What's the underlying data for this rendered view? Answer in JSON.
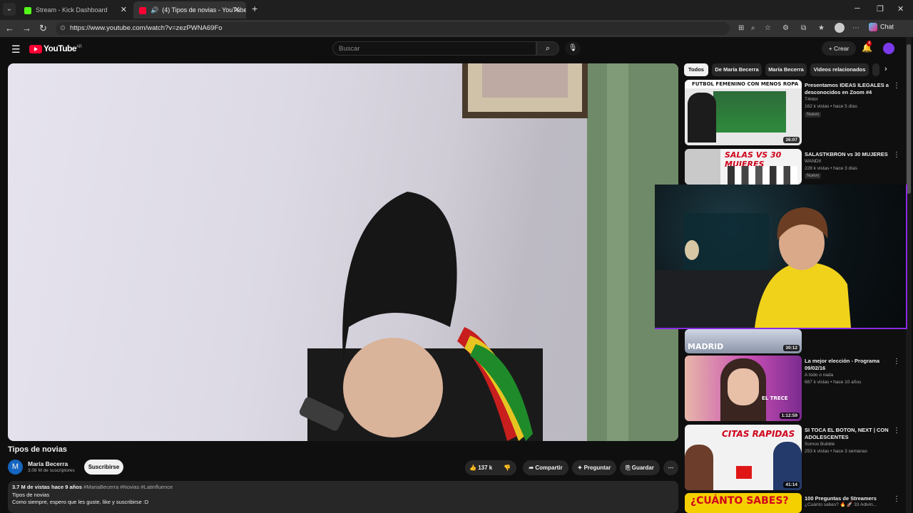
{
  "browser": {
    "tabs": [
      {
        "label": "Stream - Kick Dashboard",
        "icon": "kick-icon"
      },
      {
        "label": "(4) Tipos de novias - YouTube",
        "icon": "youtube-icon"
      }
    ],
    "url": "https://www.youtube.com/watch?v=zezPWNA69Fo",
    "chat_label": "Chat"
  },
  "youtube": {
    "logo_text": "YouTube",
    "logo_region": "AR",
    "search_placeholder": "Buscar",
    "create_label": "Crear",
    "notifications_count": "4"
  },
  "video": {
    "title": "Tipos de novias",
    "channel": "María Becerra",
    "channel_initial": "M",
    "subscribers": "3.08 M de suscriptores",
    "subscribe_label": "Suscribirse",
    "likes": "137 k",
    "share_label": "Compartir",
    "ask_label": "Preguntar",
    "save_label": "Guardar",
    "views": "3.7 M de vistas",
    "age": "hace 9 años",
    "hashtags": "#MariaBecerra #Novias #Latinfluence",
    "desc_line1": "Tipos de novias",
    "desc_line2": "Como siempre, espero que les guste, like y suscribirse :D"
  },
  "chips": [
    "Todos",
    "De María Becerra",
    "María Becerra",
    "Videos relacionados"
  ],
  "recommendations": [
    {
      "title": "Presentamos IDEAS ILEGALES a desconocidos en Zoom #4",
      "channel": "T4ntor",
      "meta": "162 k vistas • hace 5 días",
      "badge": "Nuevo",
      "duration": "36:07",
      "thumb_text": "FUTBOL FEMENINO CON MENOS ROPA"
    },
    {
      "title": "SALASTKBRON vs 30 MUJERES",
      "channel": "WANDII",
      "meta": "228 k vistas • hace 3 días",
      "badge": "Nuevo",
      "duration": "",
      "thumb_text": "SALAS VS 30 MUJERES"
    },
    {
      "title": "",
      "channel": "",
      "meta": "",
      "badge": "",
      "duration": "30:12",
      "thumb_text": "MADRID"
    },
    {
      "title": "La mejor elección - Programa 09/02/16",
      "channel": "A todo o nada",
      "meta": "687 k vistas • hace 10 años",
      "badge": "",
      "duration": "1:12:59",
      "thumb_text": "EL TRECE"
    },
    {
      "title": "SI TOCA EL BOTON, NEXT | CON ADOLESCENTES",
      "channel": "Somos Bubble",
      "meta": "253 k vistas • hace 3 semanas",
      "badge": "",
      "duration": "41:14",
      "thumb_text": "CITAS RAPIDAS"
    },
    {
      "title": "100 Preguntas de Streamers",
      "channel": "¿Cuánto sabes? 🔥 🚀 33 Adivin...",
      "meta": "",
      "badge": "",
      "duration": "",
      "thumb_text": "¿CUÁNTO SABES?"
    }
  ],
  "colors": {
    "accent": "#ff0033",
    "webcam_border": "#8a2be2",
    "subscribe_bg": "#f1f1f1"
  }
}
